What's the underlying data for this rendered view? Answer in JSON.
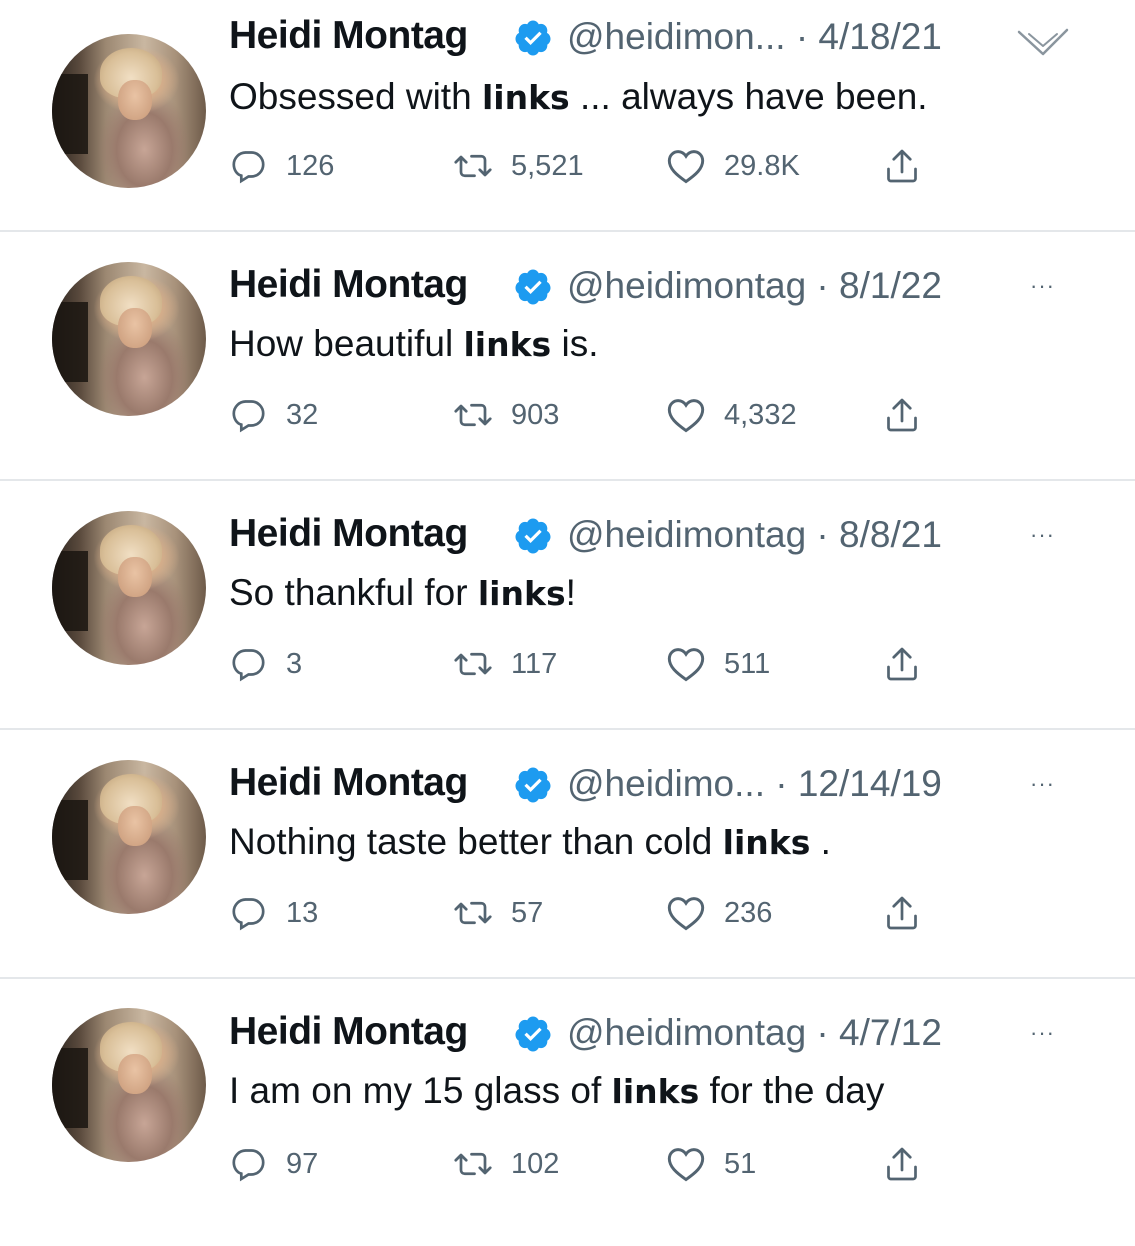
{
  "tweets": [
    {
      "name": "Heidi Montag",
      "handle_date": "@heidimon... · 4/18/21",
      "text_before": "Obsessed with ",
      "keyword": "links",
      "text_after": " ... always have been.",
      "replies": "126",
      "retweets": "5,521",
      "likes": "29.8K"
    },
    {
      "name": "Heidi Montag",
      "handle_date": "@heidimontag · 8/1/22",
      "more": "···",
      "text_before": "How beautiful ",
      "keyword": "links",
      "text_after": " is.",
      "replies": "32",
      "retweets": "903",
      "likes": "4,332"
    },
    {
      "name": "Heidi Montag",
      "handle_date": "@heidimontag · 8/8/21",
      "more": "···",
      "text_before": "So thankful for ",
      "keyword": "links",
      "text_after": "!",
      "replies": "3",
      "retweets": "117",
      "likes": "511"
    },
    {
      "name": "Heidi Montag",
      "handle_date": "@heidimo... · 12/14/19",
      "more": "···",
      "text_before": "Nothing taste better than cold ",
      "keyword": "links",
      "text_after": " .",
      "replies": "13",
      "retweets": "57",
      "likes": "236"
    },
    {
      "name": "Heidi Montag",
      "handle_date": "@heidimontag · 4/7/12",
      "more": "···",
      "text_before": "I am on my 15 glass of ",
      "keyword": "links",
      "text_after": " for the day",
      "replies": "97",
      "retweets": "102",
      "likes": "51"
    }
  ],
  "colors": {
    "text": "#0f1419",
    "muted": "#536471",
    "verified": "#1d9bf0",
    "divider": "#e4e7ea"
  },
  "icons": [
    "avatar-photo",
    "verified-badge-icon",
    "reply-icon",
    "retweet-icon",
    "like-icon",
    "share-icon",
    "more-icon",
    "chevron-down-icon"
  ]
}
